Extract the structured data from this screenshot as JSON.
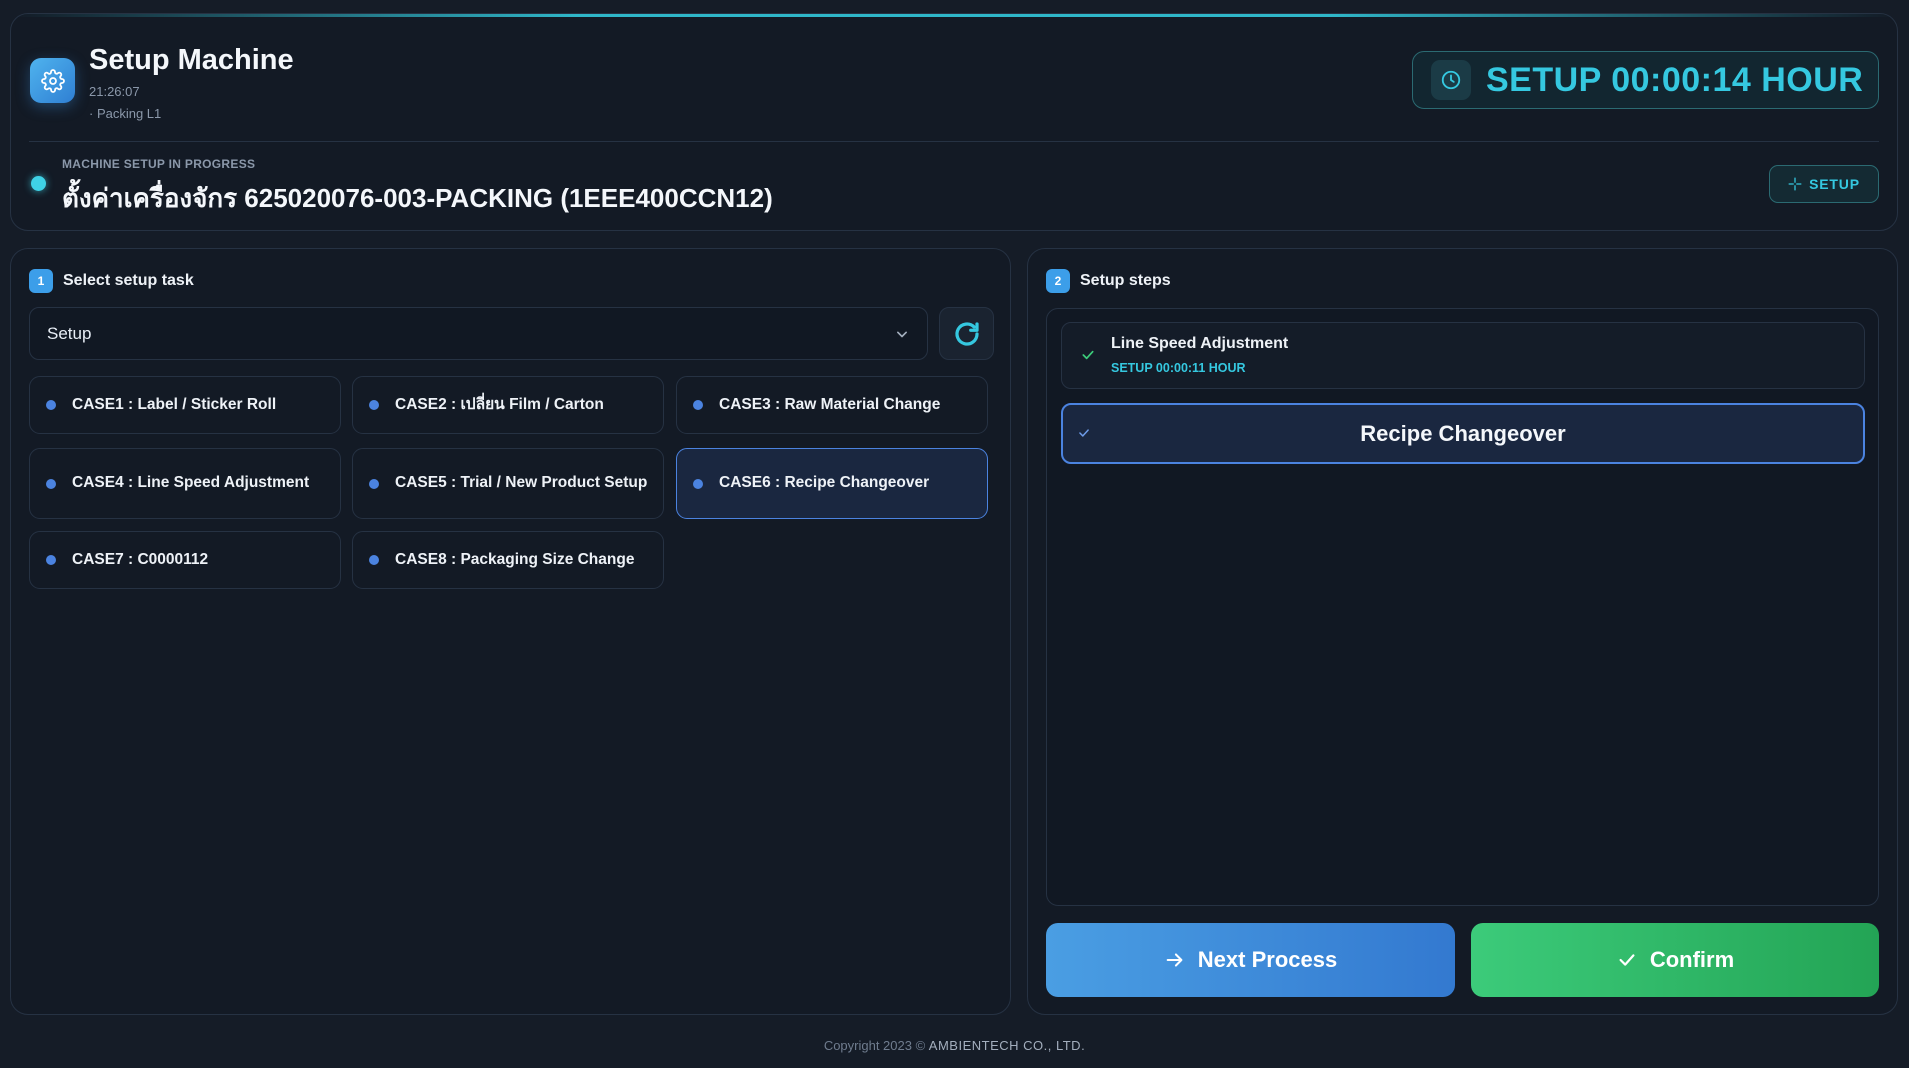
{
  "header": {
    "title": "Setup Machine",
    "time": "21:26:07",
    "line": "· Packing L1",
    "timer": "SETUP 00:00:14 HOUR",
    "status_label": "MACHINE SETUP IN PROGRESS",
    "status_title": "ตั้งค่าเครื่องจักร 625020076-003-PACKING (1EEE400CCN12)",
    "setup_button": "SETUP"
  },
  "left_panel": {
    "badge": "1",
    "title": "Select setup task",
    "select_value": "Setup",
    "cases": [
      "CASE1 : Label / Sticker Roll",
      "CASE2 : เปลี่ยน Film / Carton",
      "CASE3 : Raw Material Change",
      "CASE4 : Line Speed Adjustment",
      "CASE5 : Trial / New Product Setup",
      "CASE6 : Recipe Changeover",
      "CASE7 : C0000112",
      "CASE8 : Packaging Size Change"
    ],
    "selected_case": "CASE6 : Recipe Changeover"
  },
  "right_panel": {
    "badge": "2",
    "title": "Setup steps",
    "steps": [
      {
        "label": "Line Speed Adjustment",
        "sub": "SETUP 00:00:11 HOUR"
      },
      {
        "label": "Recipe Changeover"
      }
    ],
    "next_button": "Next Process",
    "confirm_button": "Confirm"
  },
  "footer": {
    "prefix": "Copyright 2023 ©",
    "company": "AMBIENTECH CO., LTD."
  },
  "colors": {
    "accent_cyan": "#35c8e0",
    "accent_blue": "#4b83e0",
    "confirm_green": "#2fb866",
    "next_blue": "#3f8ddb"
  }
}
